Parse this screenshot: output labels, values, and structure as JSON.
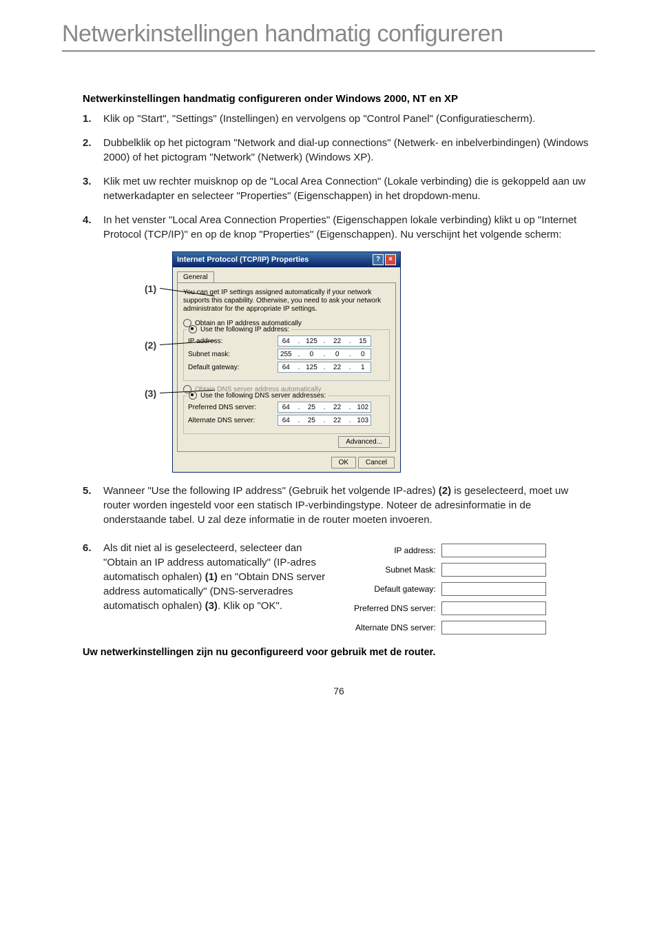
{
  "title": "Netwerkinstellingen handmatig configureren",
  "section_head": "Netwerkinstellingen handmatig configureren onder Windows 2000, NT en XP",
  "steps": {
    "s1": "Klik op \"Start\", \"Settings\" (Instellingen) en vervolgens op \"Control Panel\" (Configuratiescherm).",
    "s2": "Dubbelklik op het pictogram \"Network and dial-up connections\" (Netwerk- en inbelverbindingen) (Windows 2000) of het pictogram \"Network\" (Netwerk) (Windows XP).",
    "s3": "Klik met uw rechter muisknop op de \"Local Area Connection\" (Lokale verbinding) die is gekoppeld aan uw netwerkadapter en selecteer \"Properties\" (Eigenschappen) in het dropdown-menu.",
    "s4": "In het venster \"Local Area Connection Properties\" (Eigenschappen lokale verbinding) klikt u op \"Internet Protocol (TCP/IP)\" en op de knop \"Properties\" (Eigenschappen). Nu verschijnt het volgende scherm:",
    "s5_a": "Wanneer \"Use the following IP address\" (Gebruik het volgende IP-adres) ",
    "s5_b": "(2)",
    "s5_c": " is geselecteerd, moet uw router worden ingesteld voor een statisch IP-verbindingstype. Noteer de adresinformatie in de onderstaande tabel. U zal deze informatie in de router moeten invoeren.",
    "s6_a": "Als dit niet al is geselecteerd, selecteer dan \"Obtain an IP address automatically\" (IP-adres automatisch ophalen) ",
    "s6_b": "(1)",
    "s6_c": " en \"Obtain DNS server address automatically\" (DNS-serveradres automatisch ophalen) ",
    "s6_d": "(3)",
    "s6_e": ". Klik op \"OK\"."
  },
  "callouts": {
    "c1": "(1)",
    "c2": "(2)",
    "c3": "(3)"
  },
  "dialog": {
    "title": "Internet Protocol (TCP/IP) Properties",
    "tab": "General",
    "desc": "You can get IP settings assigned automatically if your network supports this capability. Otherwise, you need to ask your network administrator for the appropriate IP settings.",
    "radio_auto_ip": "Obtain an IP address automatically",
    "radio_use_ip": "Use the following IP address:",
    "lbl_ip": "IP address:",
    "lbl_mask": "Subnet mask:",
    "lbl_gw": "Default gateway:",
    "radio_auto_dns": "Obtain DNS server address automatically",
    "radio_use_dns": "Use the following DNS server addresses:",
    "lbl_pref_dns": "Preferred DNS server:",
    "lbl_alt_dns": "Alternate DNS server:",
    "btn_adv": "Advanced...",
    "btn_ok": "OK",
    "btn_cancel": "Cancel",
    "ip": [
      "64",
      "125",
      "22",
      "15"
    ],
    "mask": [
      "255",
      "0",
      "0",
      "0"
    ],
    "gw": [
      "64",
      "125",
      "22",
      "1"
    ],
    "pref": [
      "64",
      "25",
      "22",
      "102"
    ],
    "alt": [
      "64",
      "25",
      "22",
      "103"
    ]
  },
  "small_table": {
    "ip": "IP address:",
    "mask": "Subnet Mask:",
    "gw": "Default gateway:",
    "pref": "Preferred DNS server:",
    "alt": "Alternate DNS server:"
  },
  "closing": "Uw netwerkinstellingen zijn nu geconfigureerd voor gebruik met de router.",
  "page_num": "76"
}
